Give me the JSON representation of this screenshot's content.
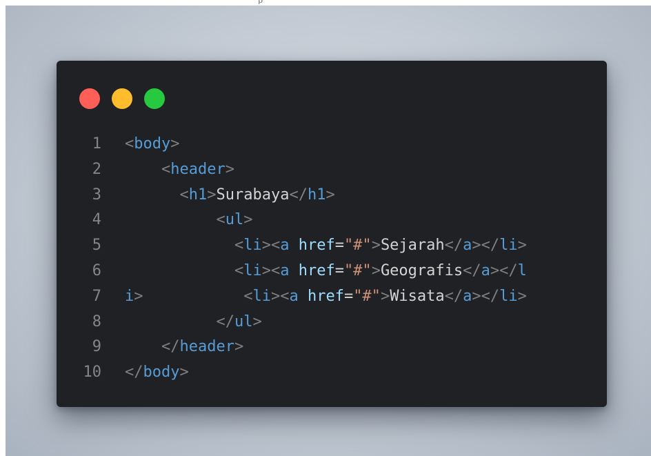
{
  "colors": {
    "window_bg": "#202124",
    "traffic_close": "#ff5f56",
    "traffic_minimize": "#ffbd2e",
    "traffic_maximize": "#27c93f",
    "line_number": "#858585",
    "tag": "#569cd6",
    "punctuation": "#808080",
    "attribute": "#9cdcfe",
    "string": "#ce9178",
    "text": "#d4d4d4"
  },
  "code_lines": [
    {
      "n": "1",
      "tokens": [
        {
          "t": "<",
          "c": "punct"
        },
        {
          "t": "body",
          "c": "tag"
        },
        {
          "t": ">",
          "c": "punct"
        }
      ]
    },
    {
      "n": "2",
      "tokens": [
        {
          "t": "    ",
          "c": "txt"
        },
        {
          "t": "<",
          "c": "punct"
        },
        {
          "t": "header",
          "c": "tag"
        },
        {
          "t": ">",
          "c": "punct"
        }
      ]
    },
    {
      "n": "3",
      "tokens": [
        {
          "t": "      ",
          "c": "txt"
        },
        {
          "t": "<",
          "c": "punct"
        },
        {
          "t": "h1",
          "c": "tag"
        },
        {
          "t": ">",
          "c": "punct"
        },
        {
          "t": "Surabaya",
          "c": "txt"
        },
        {
          "t": "</",
          "c": "punct"
        },
        {
          "t": "h1",
          "c": "tag"
        },
        {
          "t": ">",
          "c": "punct"
        }
      ]
    },
    {
      "n": "4",
      "tokens": [
        {
          "t": "          ",
          "c": "txt"
        },
        {
          "t": "<",
          "c": "punct"
        },
        {
          "t": "ul",
          "c": "tag"
        },
        {
          "t": ">",
          "c": "punct"
        }
      ]
    },
    {
      "n": "5",
      "tokens": [
        {
          "t": "            ",
          "c": "txt"
        },
        {
          "t": "<",
          "c": "punct"
        },
        {
          "t": "li",
          "c": "tag"
        },
        {
          "t": "><",
          "c": "punct"
        },
        {
          "t": "a",
          "c": "tag"
        },
        {
          "t": " ",
          "c": "txt"
        },
        {
          "t": "href",
          "c": "attr"
        },
        {
          "t": "=",
          "c": "txt"
        },
        {
          "t": "\"#\"",
          "c": "str"
        },
        {
          "t": ">",
          "c": "punct"
        },
        {
          "t": "Sejarah",
          "c": "txt"
        },
        {
          "t": "</",
          "c": "punct"
        },
        {
          "t": "a",
          "c": "tag"
        },
        {
          "t": "></",
          "c": "punct"
        },
        {
          "t": "li",
          "c": "tag"
        },
        {
          "t": ">",
          "c": "punct"
        }
      ]
    },
    {
      "n": "6",
      "tokens": [
        {
          "t": "            ",
          "c": "txt"
        },
        {
          "t": "<",
          "c": "punct"
        },
        {
          "t": "li",
          "c": "tag"
        },
        {
          "t": "><",
          "c": "punct"
        },
        {
          "t": "a",
          "c": "tag"
        },
        {
          "t": " ",
          "c": "txt"
        },
        {
          "t": "href",
          "c": "attr"
        },
        {
          "t": "=",
          "c": "txt"
        },
        {
          "t": "\"#\"",
          "c": "str"
        },
        {
          "t": ">",
          "c": "punct"
        },
        {
          "t": "Geografis",
          "c": "txt"
        },
        {
          "t": "</",
          "c": "punct"
        },
        {
          "t": "a",
          "c": "tag"
        },
        {
          "t": "></",
          "c": "punct"
        },
        {
          "t": "l",
          "c": "tag"
        }
      ]
    },
    {
      "n": "7",
      "tokens": [
        {
          "t": "i",
          "c": "tag"
        },
        {
          "t": ">",
          "c": "punct"
        },
        {
          "t": "           ",
          "c": "txt"
        },
        {
          "t": "<",
          "c": "punct"
        },
        {
          "t": "li",
          "c": "tag"
        },
        {
          "t": "><",
          "c": "punct"
        },
        {
          "t": "a",
          "c": "tag"
        },
        {
          "t": " ",
          "c": "txt"
        },
        {
          "t": "href",
          "c": "attr"
        },
        {
          "t": "=",
          "c": "txt"
        },
        {
          "t": "\"#\"",
          "c": "str"
        },
        {
          "t": ">",
          "c": "punct"
        },
        {
          "t": "Wisata",
          "c": "txt"
        },
        {
          "t": "</",
          "c": "punct"
        },
        {
          "t": "a",
          "c": "tag"
        },
        {
          "t": "></",
          "c": "punct"
        },
        {
          "t": "li",
          "c": "tag"
        },
        {
          "t": ">",
          "c": "punct"
        }
      ]
    },
    {
      "n": "8",
      "tokens": [
        {
          "t": "          ",
          "c": "txt"
        },
        {
          "t": "</",
          "c": "punct"
        },
        {
          "t": "ul",
          "c": "tag"
        },
        {
          "t": ">",
          "c": "punct"
        }
      ]
    },
    {
      "n": "9",
      "tokens": [
        {
          "t": "    ",
          "c": "txt"
        },
        {
          "t": "</",
          "c": "punct"
        },
        {
          "t": "header",
          "c": "tag"
        },
        {
          "t": ">",
          "c": "punct"
        }
      ]
    },
    {
      "n": "10",
      "tokens": [
        {
          "t": "</",
          "c": "punct"
        },
        {
          "t": "body",
          "c": "tag"
        },
        {
          "t": ">",
          "c": "punct"
        }
      ]
    }
  ]
}
